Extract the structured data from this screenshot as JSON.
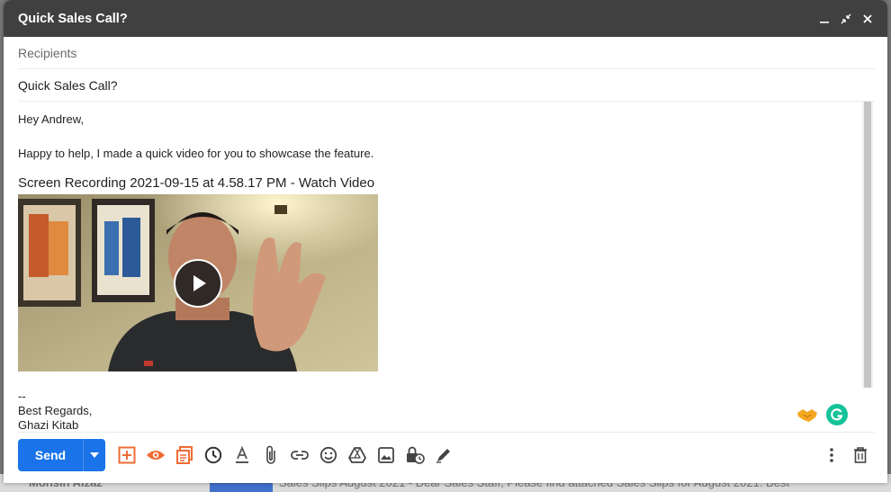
{
  "backdrop": {
    "sender": "Mohsin Aizaz",
    "subject": "Sales Slips August 2021 - Dear Sales Staff, Please find attached Sales Slips for August 2021. Best"
  },
  "window": {
    "title": "Quick Sales Call?",
    "controls": [
      "minimize-icon",
      "exit-fullscreen-icon",
      "close-icon"
    ]
  },
  "recipients": {
    "placeholder": "Recipients"
  },
  "subject": {
    "value": "Quick Sales Call?"
  },
  "body": {
    "greeting": "Hey Andrew,",
    "intro": "Happy to help, I made a quick video for you to showcase the feature.",
    "video_link": "Screen Recording 2021-09-15 at 4.58.17 PM - Watch Video",
    "signature_dash": "--",
    "signature_regards": "Best Regards,",
    "signature_name": "Ghazi Kitab"
  },
  "toolbar": {
    "send_label": "Send",
    "icons": [
      "add-icon",
      "eye-icon",
      "templates-icon",
      "clock-icon",
      "text-format-icon",
      "attach-icon",
      "link-icon",
      "emoji-icon",
      "drive-icon",
      "photo-icon",
      "confidential-icon",
      "signature-icon"
    ],
    "right_icons": [
      "more-options-icon",
      "trash-icon"
    ]
  },
  "colors": {
    "titlebar": "#404040",
    "send": "#1a73e8",
    "addon_orange": "#ef6c35",
    "grammarly": "#15c39a"
  }
}
